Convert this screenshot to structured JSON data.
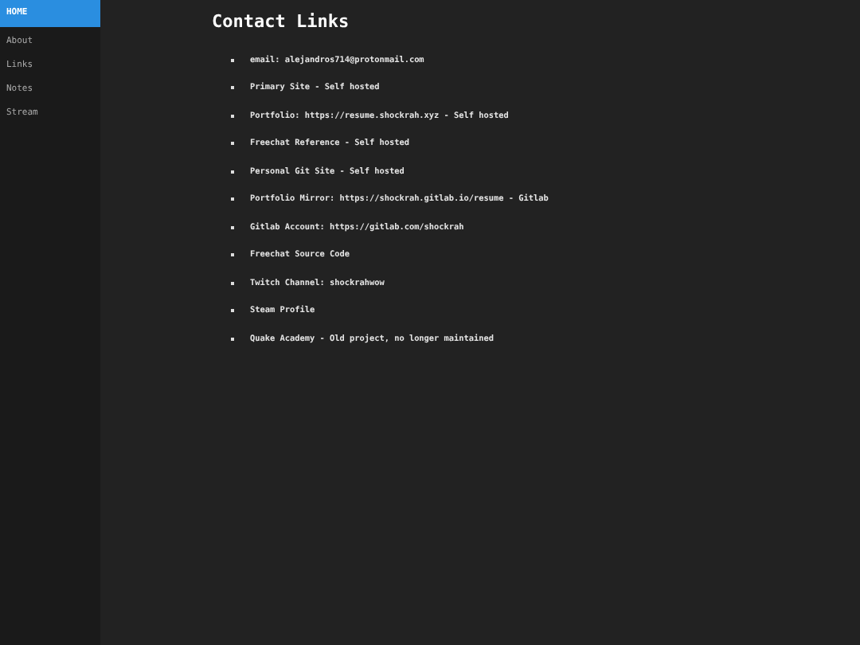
{
  "sidebar": {
    "items": [
      {
        "label": "HOME",
        "selected": true
      },
      {
        "label": "About",
        "selected": false
      },
      {
        "label": "Links",
        "selected": false
      },
      {
        "label": "Notes",
        "selected": false
      },
      {
        "label": "Stream",
        "selected": false
      }
    ]
  },
  "main": {
    "title": "Contact Links",
    "items": [
      "email: alejandros714@protonmail.com",
      "Primary Site - Self hosted",
      "Portfolio: https://resume.shockrah.xyz - Self hosted",
      "Freechat Reference - Self hosted",
      "Personal Git Site - Self hosted",
      "Portfolio Mirror: https://shockrah.gitlab.io/resume - Gitlab",
      "Gitlab Account: https://gitlab.com/shockrah",
      "Freechat Source Code",
      "Twitch Channel: shockrahwow",
      "Steam Profile",
      "Quake Academy - Old project, no longer maintained"
    ]
  }
}
